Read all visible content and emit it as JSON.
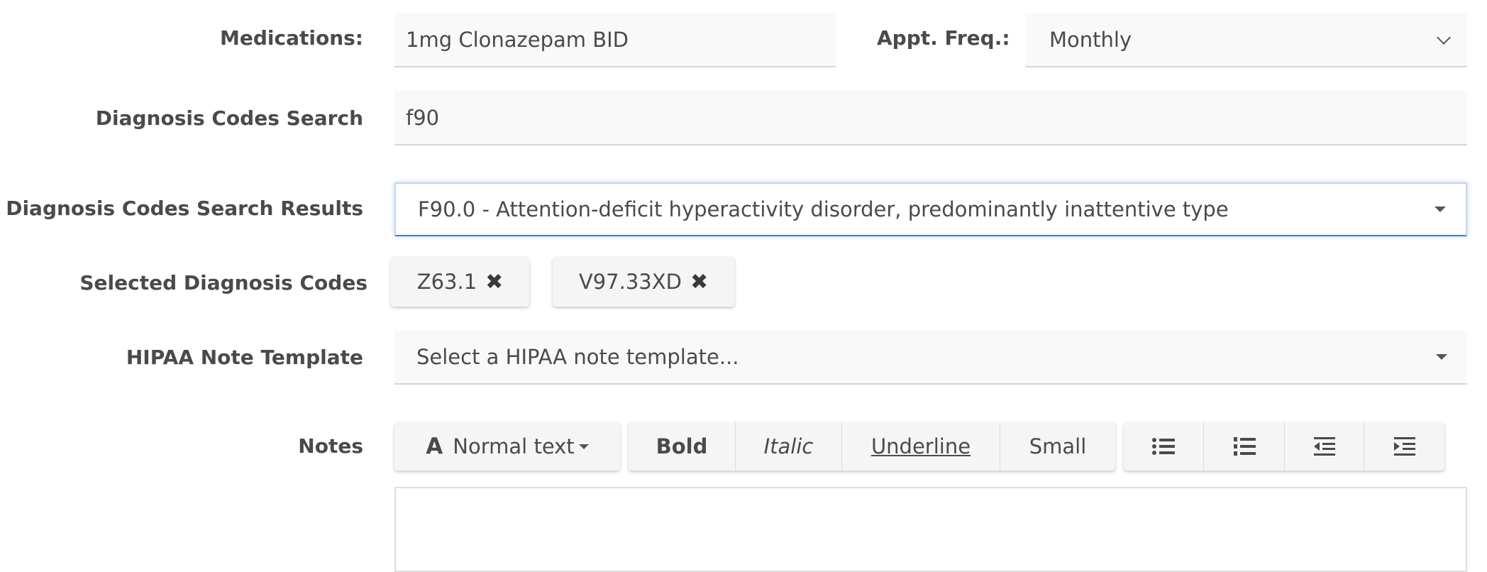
{
  "medications": {
    "label": "Medications:",
    "value": "1mg Clonazepam BID"
  },
  "appt_freq": {
    "label": "Appt. Freq.:",
    "value": "Monthly"
  },
  "dx_search": {
    "label": "Diagnosis Codes Search",
    "value": "f90"
  },
  "dx_results": {
    "label": "Diagnosis Codes Search Results",
    "value": "F90.0 - Attention-deficit hyperactivity disorder, predominantly inattentive type"
  },
  "selected_codes": {
    "label": "Selected Diagnosis Codes",
    "chips": [
      {
        "code": "Z63.1",
        "remove": "✖"
      },
      {
        "code": "V97.33XD",
        "remove": "✖"
      }
    ]
  },
  "hipaa": {
    "label": "HIPAA Note Template",
    "placeholder": "Select a HIPAA note template..."
  },
  "notes": {
    "label": "Notes",
    "toolbar": {
      "format_icon": "A",
      "format_label": "Normal text",
      "bold": "Bold",
      "italic": "Italic",
      "underline": "Underline",
      "small": "Small",
      "icons": [
        "bulleted-list-icon",
        "numbered-list-icon",
        "outdent-icon",
        "indent-icon"
      ]
    },
    "value": ""
  },
  "colors": {
    "focus_border": "#3b82d6",
    "field_bg": "#f9f9f9",
    "label": "#4a4a4a"
  }
}
